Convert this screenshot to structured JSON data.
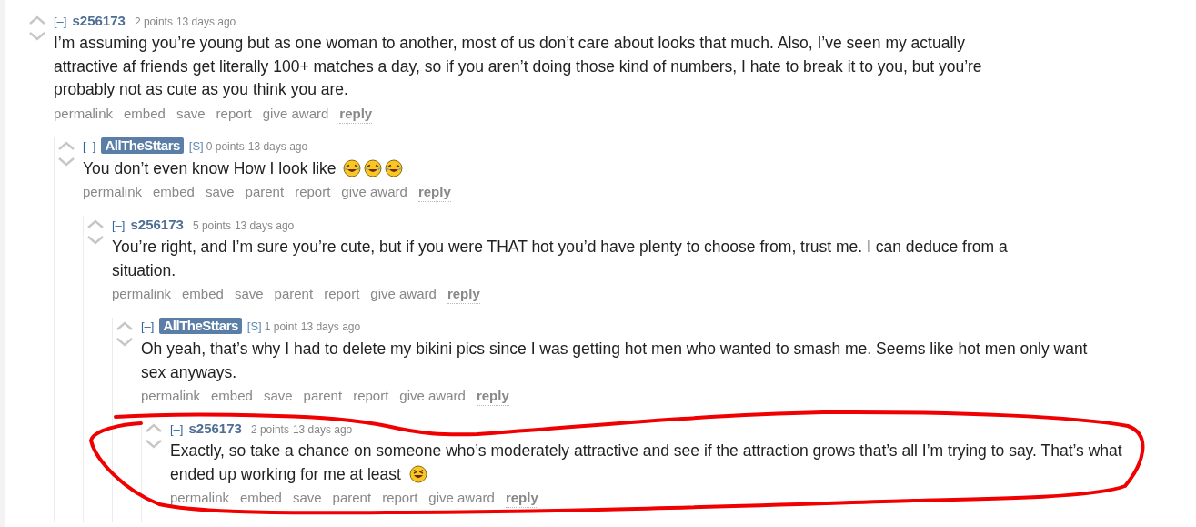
{
  "comments": [
    {
      "author": "s256173",
      "submitter": false,
      "score": "2 points",
      "time": "13 days ago",
      "body": "I’m assuming you’re young but as one woman to another, most of us don’t care about looks that much. Also, I’ve seen my actually attractive af friends get literally 100+ matches a day, so if you aren’t doing those kind of numbers, I hate to break it to you, but you’re probably not as cute as you think you are.",
      "actions": [
        {
          "label": "permalink",
          "kind": "link"
        },
        {
          "label": "embed",
          "kind": "link"
        },
        {
          "label": "save",
          "kind": "link"
        },
        {
          "label": "report",
          "kind": "link"
        },
        {
          "label": "give award",
          "kind": "link"
        },
        {
          "label": "reply",
          "kind": "reply"
        }
      ],
      "children": [
        {
          "author": "AllTheSttars",
          "submitter": true,
          "submitter_mark": "[S]",
          "score": "0 points",
          "time": "13 days ago",
          "body": "You don’t even know How I look like",
          "trailing_icons": [
            {
              "kind": "tears_of_joy"
            },
            {
              "kind": "tears_of_joy"
            },
            {
              "kind": "tears_of_joy"
            }
          ],
          "actions": [
            {
              "label": "permalink",
              "kind": "link"
            },
            {
              "label": "embed",
              "kind": "link"
            },
            {
              "label": "save",
              "kind": "link"
            },
            {
              "label": "parent",
              "kind": "link"
            },
            {
              "label": "report",
              "kind": "link"
            },
            {
              "label": "give award",
              "kind": "link"
            },
            {
              "label": "reply",
              "kind": "reply"
            }
          ],
          "children": [
            {
              "author": "s256173",
              "submitter": false,
              "score": "5 points",
              "time": "13 days ago",
              "body": "You’re right, and I’m sure you’re cute, but if you were THAT hot you’d have plenty to choose from, trust me. I can deduce from a situation.",
              "actions": [
                {
                  "label": "permalink",
                  "kind": "link"
                },
                {
                  "label": "embed",
                  "kind": "link"
                },
                {
                  "label": "save",
                  "kind": "link"
                },
                {
                  "label": "parent",
                  "kind": "link"
                },
                {
                  "label": "report",
                  "kind": "link"
                },
                {
                  "label": "give award",
                  "kind": "link"
                },
                {
                  "label": "reply",
                  "kind": "reply"
                }
              ],
              "children": [
                {
                  "author": "AllTheSttars",
                  "submitter": true,
                  "submitter_mark": "[S]",
                  "score": "1 point",
                  "time": "13 days ago",
                  "body": "Oh yeah, that’s why I had to delete my bikini pics since I was getting hot men who wanted to smash me. Seems like hot men only want sex anyways.",
                  "actions": [
                    {
                      "label": "permalink",
                      "kind": "link"
                    },
                    {
                      "label": "embed",
                      "kind": "link"
                    },
                    {
                      "label": "save",
                      "kind": "link"
                    },
                    {
                      "label": "parent",
                      "kind": "link"
                    },
                    {
                      "label": "report",
                      "kind": "link"
                    },
                    {
                      "label": "give award",
                      "kind": "link"
                    },
                    {
                      "label": "reply",
                      "kind": "reply"
                    }
                  ],
                  "children": [
                    {
                      "author": "s256173",
                      "submitter": false,
                      "score": "2 points",
                      "time": "13 days ago",
                      "body": "Exactly, so take a chance on someone who’s moderately attractive and see if the attraction grows that’s all I’m trying to say. That’s what ended up working for me at least",
                      "trailing_icons": [
                        {
                          "kind": "grinning_squint"
                        }
                      ],
                      "actions": [
                        {
                          "label": "permalink",
                          "kind": "link"
                        },
                        {
                          "label": "embed",
                          "kind": "link"
                        },
                        {
                          "label": "save",
                          "kind": "link"
                        },
                        {
                          "label": "parent",
                          "kind": "link"
                        },
                        {
                          "label": "report",
                          "kind": "link"
                        },
                        {
                          "label": "give award",
                          "kind": "link"
                        },
                        {
                          "label": "reply",
                          "kind": "reply"
                        }
                      ]
                    }
                  ]
                }
              ]
            }
          ]
        }
      ]
    }
  ],
  "collapse_label": "[–]",
  "annotation": {
    "kind": "loop"
  }
}
